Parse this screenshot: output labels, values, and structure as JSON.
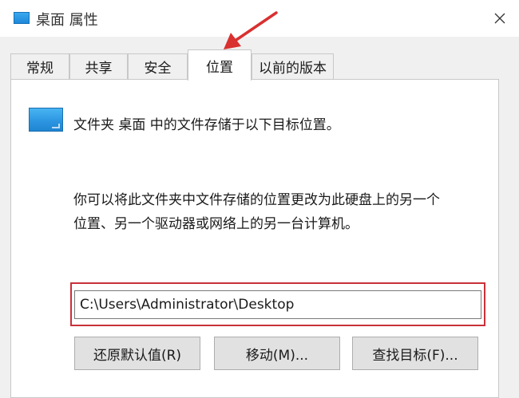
{
  "window": {
    "title": "桌面 属性"
  },
  "tabs": [
    {
      "label": "常规"
    },
    {
      "label": "共享"
    },
    {
      "label": "安全"
    },
    {
      "label": "位置",
      "active": true
    },
    {
      "label": "以前的版本"
    }
  ],
  "location": {
    "info": "文件夹 桌面 中的文件存储于以下目标位置。",
    "description_line1": "你可以将此文件夹中文件存储的位置更改为此硬盘上的另一个",
    "description_line2": "位置、另一个驱动器或网络上的另一台计算机。",
    "path_value": "C:\\Users\\Administrator\\Desktop"
  },
  "buttons": {
    "restore_default": "还原默认值(R)",
    "move": "移动(M)...",
    "find_target": "查找目标(F)..."
  },
  "colors": {
    "highlight": "#c9313a",
    "arrow": "#d93030",
    "folder": "#2b94e0"
  },
  "icons": {
    "window": "folder-icon",
    "close": "close-icon",
    "content": "folder-icon"
  }
}
